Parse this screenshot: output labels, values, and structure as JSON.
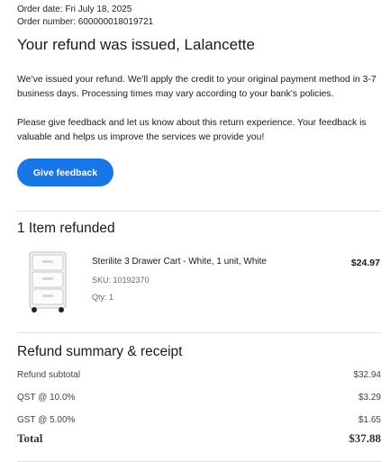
{
  "order": {
    "date_line": "Order date: Fri July 18, 2025",
    "number_line": "Order number: 600000018019721"
  },
  "headline": "Your refund was issued, Lalancette",
  "paragraphs": {
    "refund_info": "We’ve issued your refund. We’ll apply the credit to your original payment method in 3-7 business days. Processing times may vary according to your bank’s policies.",
    "feedback_info": "Please give feedback and let us know about this return experience. Your feedback is valuable and helps us improve the services we provide you!"
  },
  "feedback_button_label": "Give feedback",
  "items_section": {
    "title": "1 Item refunded",
    "items": [
      {
        "name": "Sterilite 3 Drawer Cart - White, 1 unit, White",
        "sku": "SKU: 10192370",
        "qty": "Qty: 1",
        "price": "$24.97",
        "icon": "drawer-cart-image"
      }
    ]
  },
  "summary": {
    "title": "Refund summary & receipt",
    "rows": [
      {
        "label": "Refund subtotal",
        "value": "$32.94"
      },
      {
        "label": "QST @ 10.0%",
        "value": "$3.29"
      },
      {
        "label": "GST @ 5.00%",
        "value": "$1.65"
      }
    ],
    "total_label": "Total",
    "total_value": "$37.88"
  },
  "colors": {
    "accent": "#1976e6",
    "divider": "#e3e3e3",
    "muted_text": "#6a6a6a"
  }
}
